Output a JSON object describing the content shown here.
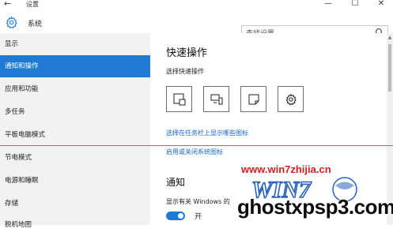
{
  "window": {
    "title": "设置",
    "back_glyph": "←",
    "minimize_glyph": "—",
    "maximize_glyph": "☐",
    "close_glyph": "✕"
  },
  "header": {
    "icon": "gear-icon",
    "title": "系统",
    "search_placeholder": "查找设置",
    "search_icon": "search-icon"
  },
  "sidebar": {
    "items": [
      {
        "label": "显示",
        "active": false
      },
      {
        "label": "通知和操作",
        "active": true
      },
      {
        "label": "应用和功能",
        "active": false
      },
      {
        "label": "多任务",
        "active": false
      },
      {
        "label": "平板电脑模式",
        "active": false
      },
      {
        "label": "节电模式",
        "active": false
      },
      {
        "label": "电源和睡眠",
        "active": false
      },
      {
        "label": "存储",
        "active": false
      },
      {
        "label": "脱机地图",
        "active": false
      }
    ]
  },
  "main": {
    "quick_actions_title": "快速操作",
    "quick_actions_subtitle": "选择快速操作",
    "quick_tiles": [
      {
        "icon": "tablet-mode-icon"
      },
      {
        "icon": "connect-display-icon"
      },
      {
        "icon": "note-icon"
      },
      {
        "icon": "settings-icon"
      }
    ],
    "link_taskbar_icons": "选择在任务栏上显示哪些图标",
    "link_system_icons": "启用或关闭系统图标",
    "notifications_title": "通知",
    "notifications_desc": "显示有关 Windows 的",
    "toggle_state": "开",
    "toggle_on": true
  },
  "watermark": {
    "url_text": "www.win7zhijia.cn",
    "domain_text": "ghostxpsp3.com"
  },
  "colors": {
    "accent": "#1f7ad4",
    "link": "#1466c2",
    "sidebar_bg": "#f2f2f2",
    "watermark_red": "#d81e1e"
  }
}
